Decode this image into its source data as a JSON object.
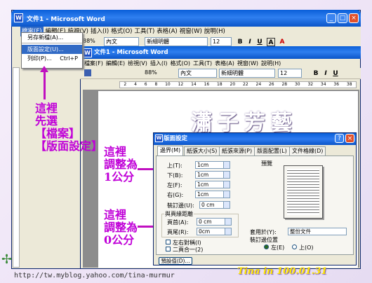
{
  "outer": {
    "title": "文件1 - Microsoft Word",
    "menus": [
      "檔案(F)",
      "編輯(E)",
      "檢視(V)",
      "插入(I)",
      "格式(O)",
      "工具(T)",
      "表格(A)",
      "視窗(W)",
      "說明(H)"
    ],
    "zoom": "88%",
    "style": "內文",
    "font": "新細明體",
    "size": "12"
  },
  "file_menu": {
    "items": [
      "另存新檔(A)...",
      "版面設定(U)...",
      "列印(P)..."
    ],
    "print_shortcut": "Ctrl+P"
  },
  "inner": {
    "title": "文件1 - Microsoft Word",
    "menus": [
      "檔案(F)",
      "編輯(E)",
      "檢視(V)",
      "插入(I)",
      "格式(O)",
      "工具(T)",
      "表格(A)",
      "視窗(W)",
      "說明(H)"
    ],
    "zoom": "88%",
    "style": "內文",
    "font": "新細明體",
    "size": "12"
  },
  "ruler_marks": [
    "2",
    "4",
    "6",
    "8",
    "10",
    "12",
    "14",
    "16",
    "18",
    "20",
    "22",
    "24",
    "26",
    "28",
    "30",
    "32",
    "34",
    "36",
    "38"
  ],
  "annotations": {
    "a1": [
      "這裡",
      "先選",
      "【檔案】",
      "【版面設定】"
    ],
    "a2": [
      "這裡",
      "調整為",
      "1公分"
    ],
    "a3": [
      "這裡",
      "調整為",
      "0公分"
    ]
  },
  "watermark": "瀟子芳藝",
  "dialog": {
    "title": "版面設定",
    "tabs": [
      "邊界(M)",
      "紙張大小(S)",
      "紙張來源(P)",
      "版面配置(L)",
      "文件格線(D)"
    ],
    "margins": [
      {
        "label": "上(T):",
        "value": "1cm"
      },
      {
        "label": "下(B):",
        "value": "1cm"
      },
      {
        "label": "左(F):",
        "value": "1cm"
      },
      {
        "label": "右(G):",
        "value": "1cm"
      }
    ],
    "gutter_label": "裝訂邊(U):",
    "gutter_value": "0 cm",
    "edge_group": "與頁緣距離",
    "header_label": "頁首(A):",
    "header_value": "0 cm",
    "footer_label": "頁尾(R):",
    "footer_value": "0cm",
    "mirror": "左右對稱(I)",
    "two_pages": "二頁合一(2)",
    "preview": "預覽",
    "apply_label": "套用於(Y):",
    "apply_value": "整份文件",
    "gutter_pos": "裝訂邊位置",
    "left_opt": "左(E)",
    "top_opt": "上(O)",
    "default_btn": "預設值(D)...",
    "help": "?",
    "close": "×"
  },
  "footer": {
    "url": "http://tw.myblog.yahoo.com/tina-murmur",
    "sig": "Tina in 100.01.31"
  }
}
